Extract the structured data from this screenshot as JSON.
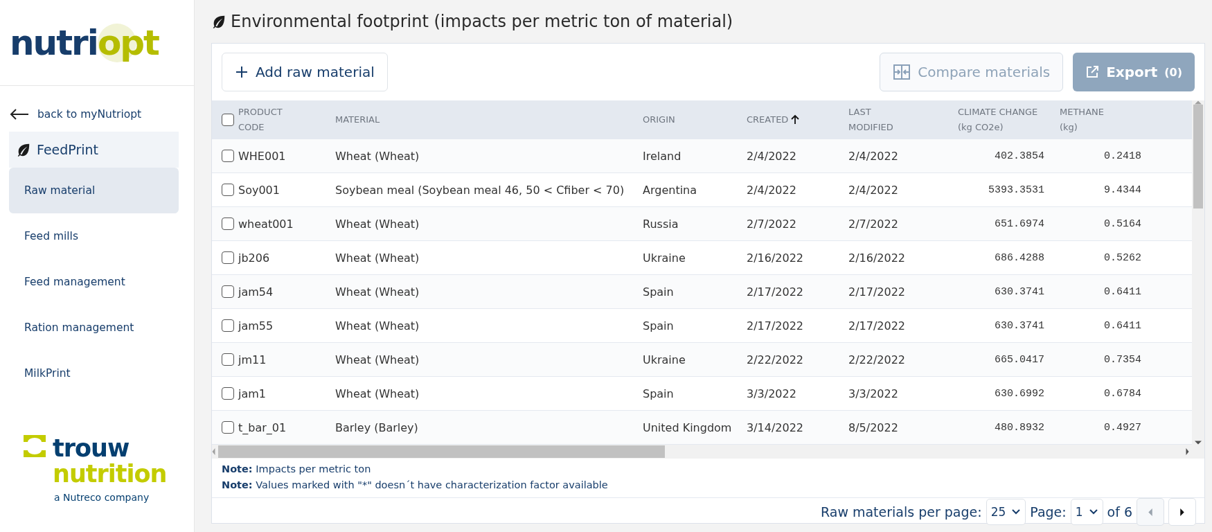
{
  "sidebar": {
    "logo": {
      "part_1": "nutri",
      "part_2": "opt"
    },
    "back_link": "back to myNutriopt",
    "section": "FeedPrint",
    "items": [
      {
        "label": "Raw material",
        "selected": true
      },
      {
        "label": "Feed mills",
        "selected": false
      },
      {
        "label": "Feed management",
        "selected": false
      },
      {
        "label": "Ration management",
        "selected": false
      },
      {
        "label": "MilkPrint",
        "selected": false
      }
    ],
    "footer_logo": {
      "line_1": "trouw",
      "line_2": "nutrition",
      "tagline": "a Nutreco company"
    }
  },
  "page_title": "Environmental footprint (impacts per metric ton of material)",
  "toolbar": {
    "add_button": {
      "label": "Add raw material",
      "disabled": false
    },
    "compare_button": {
      "label": "Compare materials",
      "disabled": true
    },
    "export_button": {
      "label": "Export",
      "count": "(0)",
      "disabled": true
    }
  },
  "table": {
    "select_all": {
      "checked": false
    },
    "columns": [
      {
        "line_1": "PRODUCT",
        "line_2": "CODE",
        "sorted": false,
        "kind": "text"
      },
      {
        "line_1": "MATERIAL",
        "sorted": false,
        "kind": "text"
      },
      {
        "line_1": "ORIGIN",
        "sorted": false,
        "kind": "text"
      },
      {
        "line_1": "CREATED",
        "sorted": true,
        "kind": "text"
      },
      {
        "line_1": "LAST",
        "line_2": "MODIFIED",
        "sorted": false,
        "kind": "text"
      },
      {
        "line_1": "CLIMATE CHANGE",
        "line_2": "(kg CO2e)",
        "sorted": false,
        "kind": "numeric"
      },
      {
        "line_1": "METHANE",
        "line_2": "(kg)",
        "sorted": false,
        "kind": "numeric"
      }
    ],
    "rows": [
      {
        "checked": false,
        "cells": [
          "WHE001",
          "Wheat (Wheat)",
          "Ireland",
          "2/4/2022",
          "2/4/2022",
          "402.3854",
          "0.2418"
        ]
      },
      {
        "checked": false,
        "cells": [
          "Soy001",
          "Soybean meal (Soybean meal 46, 50 < Cfiber < 70)",
          "Argentina",
          "2/4/2022",
          "2/4/2022",
          "5393.3531",
          "9.4344"
        ]
      },
      {
        "checked": false,
        "cells": [
          "wheat001",
          "Wheat (Wheat)",
          "Russia",
          "2/7/2022",
          "2/7/2022",
          "651.6974",
          "0.5164"
        ]
      },
      {
        "checked": false,
        "cells": [
          "jb206",
          "Wheat (Wheat)",
          "Ukraine",
          "2/16/2022",
          "2/16/2022",
          "686.4288",
          "0.5262"
        ]
      },
      {
        "checked": false,
        "cells": [
          "jam54",
          "Wheat (Wheat)",
          "Spain",
          "2/17/2022",
          "2/17/2022",
          "630.3741",
          "0.6411"
        ]
      },
      {
        "checked": false,
        "cells": [
          "jam55",
          "Wheat (Wheat)",
          "Spain",
          "2/17/2022",
          "2/17/2022",
          "630.3741",
          "0.6411"
        ]
      },
      {
        "checked": false,
        "cells": [
          "jm11",
          "Wheat (Wheat)",
          "Ukraine",
          "2/22/2022",
          "2/22/2022",
          "665.0417",
          "0.7354"
        ]
      },
      {
        "checked": false,
        "cells": [
          "jam1",
          "Wheat (Wheat)",
          "Spain",
          "3/3/2022",
          "3/3/2022",
          "630.6992",
          "0.6784"
        ]
      },
      {
        "checked": false,
        "cells": [
          "t_bar_01",
          "Barley (Barley)",
          "United Kingdom",
          "3/14/2022",
          "8/5/2022",
          "480.8932",
          "0.4927"
        ]
      }
    ]
  },
  "notes": [
    "**Note:** Impacts per metric ton",
    "**Note:** Values marked with \"*\" doesn´t have characterization factor available"
  ],
  "pagination": {
    "per_page_label": "Raw materials per page:",
    "per_page": "25",
    "page_label": "Page:",
    "page": "1",
    "of_pages": "of 6",
    "prev_disabled": true,
    "next_disabled": false
  }
}
